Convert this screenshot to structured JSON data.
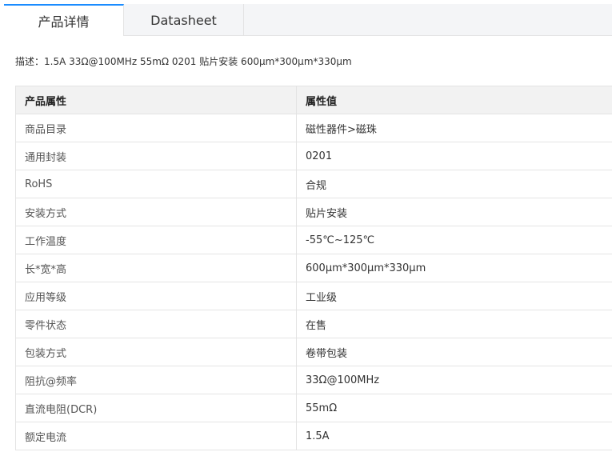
{
  "tabs": [
    {
      "label": "产品详情",
      "active": true
    },
    {
      "label": "Datasheet",
      "active": false
    }
  ],
  "description": "描述：1.5A 33Ω@100MHz 55mΩ 0201 贴片安装 600μm*300μm*330μm",
  "table": {
    "headers": [
      "产品属性",
      "属性值"
    ],
    "rows": [
      {
        "name": "商品目录",
        "value": "磁性器件>磁珠"
      },
      {
        "name": "通用封装",
        "value": "0201"
      },
      {
        "name": "RoHS",
        "value": "合规"
      },
      {
        "name": "安装方式",
        "value": "贴片安装"
      },
      {
        "name": "工作温度",
        "value": "-55℃~125℃"
      },
      {
        "name": "长*宽*高",
        "value": "600μm*300μm*330μm"
      },
      {
        "name": "应用等级",
        "value": "工业级"
      },
      {
        "name": "零件状态",
        "value": "在售"
      },
      {
        "name": "包装方式",
        "value": "卷带包装"
      },
      {
        "name": "阻抗@频率",
        "value": "33Ω@100MHz"
      },
      {
        "name": "直流电阻(DCR)",
        "value": "55mΩ"
      },
      {
        "name": "额定电流",
        "value": "1.5A"
      }
    ]
  },
  "colors": {
    "accent": "#1a8cff",
    "tab_bar_bg": "#f4f5f7",
    "header_bg": "#f2f2f2",
    "border": "#e3e3e3"
  }
}
